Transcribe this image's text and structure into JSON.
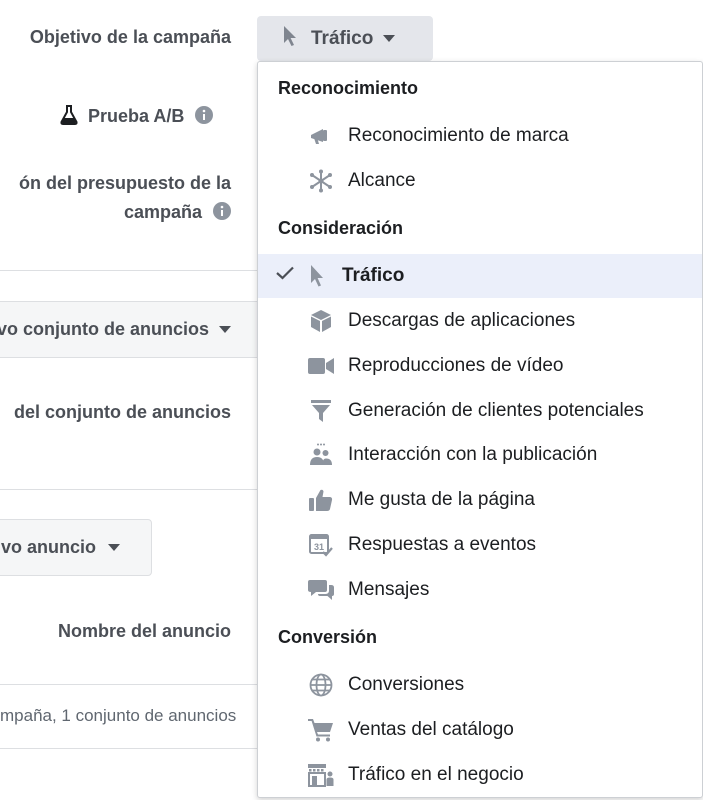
{
  "form": {
    "objective_label": "Objetivo de la campaña",
    "objective_value": "Tráfico",
    "ab_test_label": "Prueba A/B",
    "budget_label_line1": "ón del presupuesto de la",
    "budget_label_line2": "campaña",
    "adset_selector": "vo conjunto de anuncios",
    "adset_name_label": "del conjunto de anuncios",
    "ad_selector": "vo anuncio",
    "ad_name_label": "Nombre del anuncio",
    "summary_text": "mpaña, 1 conjunto de anuncios"
  },
  "menu": {
    "sections": [
      {
        "title": "Reconocimiento",
        "items": [
          {
            "label": "Reconocimiento de marca",
            "icon": "megaphone-icon"
          },
          {
            "label": "Alcance",
            "icon": "asterisk-network-icon"
          }
        ]
      },
      {
        "title": "Consideración",
        "items": [
          {
            "label": "Tráfico",
            "icon": "cursor-icon",
            "selected": true
          },
          {
            "label": "Descargas de aplicaciones",
            "icon": "package-icon"
          },
          {
            "label": "Reproducciones de vídeo",
            "icon": "video-camera-icon"
          },
          {
            "label": "Generación de clientes potenciales",
            "icon": "funnel-icon"
          },
          {
            "label": "Interacción con la publicación",
            "icon": "people-icon"
          },
          {
            "label": "Me gusta de la página",
            "icon": "thumbs-up-icon"
          },
          {
            "label": "Respuestas a eventos",
            "icon": "calendar-check-icon"
          },
          {
            "label": "Mensajes",
            "icon": "chat-bubbles-icon"
          }
        ]
      },
      {
        "title": "Conversión",
        "items": [
          {
            "label": "Conversiones",
            "icon": "globe-icon"
          },
          {
            "label": "Ventas del catálogo",
            "icon": "shopping-cart-icon"
          },
          {
            "label": "Tráfico en el negocio",
            "icon": "storefront-icon"
          }
        ]
      }
    ]
  },
  "colors": {
    "label_gray": "#4b4f56",
    "icon_gray": "#8d949e",
    "selected_bg": "#ebeffa"
  }
}
